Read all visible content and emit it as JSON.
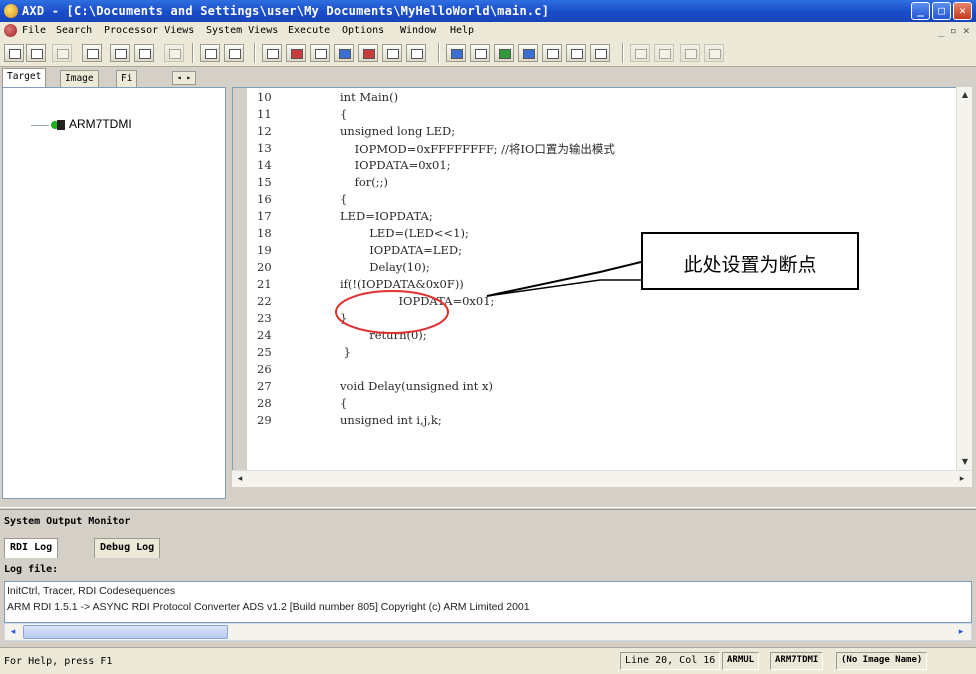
{
  "window": {
    "title": "AXD - [C:\\Documents and Settings\\user\\My Documents\\MyHelloWorld\\main.c]",
    "controls": [
      "_",
      "□",
      "✕"
    ],
    "mdi_controls": [
      "_",
      "▫",
      "✕"
    ]
  },
  "menu": {
    "items": [
      "File",
      "Search",
      "Processor Views",
      "System Views",
      "Execute",
      "Options",
      "Window",
      "Help"
    ]
  },
  "left_pane": {
    "tabs": [
      "Target",
      "Image",
      "Fi"
    ],
    "tab_scroll": "◂ ▸",
    "tree": {
      "node_label": "ARM7TDMI"
    }
  },
  "code": {
    "lines": [
      {
        "n": "10",
        "text": "int Main()"
      },
      {
        "n": "11",
        "text": "{"
      },
      {
        "n": "12",
        "text": "unsigned long LED;"
      },
      {
        "n": "13",
        "text": "    IOPMOD=0xFFFFFFFF; //将IO口置为输出模式"
      },
      {
        "n": "14",
        "text": "    IOPDATA=0x01;"
      },
      {
        "n": "15",
        "text": "    for(;;)"
      },
      {
        "n": "16",
        "text": "{"
      },
      {
        "n": "17",
        "text": "LED=IOPDATA;"
      },
      {
        "n": "18",
        "text": "        LED=(LED<<1);"
      },
      {
        "n": "19",
        "text": "        IOPDATA=LED;"
      },
      {
        "n": "20",
        "text": "        Delay(10);"
      },
      {
        "n": "21",
        "text": "if(!(IOPDATA&0x0F))"
      },
      {
        "n": "22",
        "text": "                IOPDATA=0x01;"
      },
      {
        "n": "23",
        "text": "}"
      },
      {
        "n": "24",
        "text": "        return(0);"
      },
      {
        "n": "25",
        "text": " }"
      },
      {
        "n": "26",
        "text": ""
      },
      {
        "n": "27",
        "text": "void Delay(unsigned int x)"
      },
      {
        "n": "28",
        "text": "{"
      },
      {
        "n": "29",
        "text": "unsigned int i,j,k;"
      }
    ]
  },
  "annotation": {
    "callout_text": "此处设置为断点"
  },
  "output": {
    "title": "System Output Monitor",
    "tabs": [
      "RDI Log",
      "Debug Log"
    ],
    "log_label": "Log file:",
    "log_lines": [
      "InitCtrl, Tracer, RDI Codesequences",
      "ARM RDI 1.5.1 -> ASYNC RDI Protocol Converter ADS v1.2 [Build number 805] Copyright (c) ARM Limited 2001"
    ]
  },
  "status": {
    "help": "For Help, press F1",
    "position": "Line 20, Col 16",
    "mode": "ARMUL",
    "target": "ARM7TDMI",
    "image": "(No Image Name)"
  },
  "colors": {
    "title_bar": "#1a4cc9",
    "annotation_circle": "#e03030",
    "tree_icon": "#1db21d"
  }
}
